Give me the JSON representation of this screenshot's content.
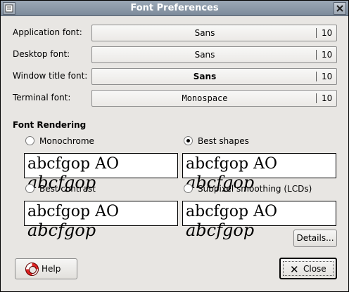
{
  "window": {
    "title": "Font Preferences"
  },
  "fonts": [
    {
      "label": "Application font:",
      "name": "Sans",
      "size": "10"
    },
    {
      "label": "Desktop font:",
      "name": "Sans",
      "size": "10"
    },
    {
      "label": "Window title font:",
      "name": "Sans",
      "size": "10"
    },
    {
      "label": "Terminal font:",
      "name": "Monospace",
      "size": "10"
    }
  ],
  "rendering": {
    "title": "Font Rendering",
    "options": [
      {
        "label": "Monochrome",
        "selected": false
      },
      {
        "label": "Best shapes",
        "selected": true
      },
      {
        "label": "Best contrast",
        "selected": false
      },
      {
        "label": "Subpixel smoothing (LCDs)",
        "selected": false
      }
    ],
    "sample_plain": "abcfgop AO ",
    "sample_italic": "abcfgop"
  },
  "buttons": {
    "details": "Details...",
    "help": "Help",
    "close": "Close"
  },
  "icons": {
    "help": "lifebuoy-icon",
    "close": "close-x-icon"
  }
}
